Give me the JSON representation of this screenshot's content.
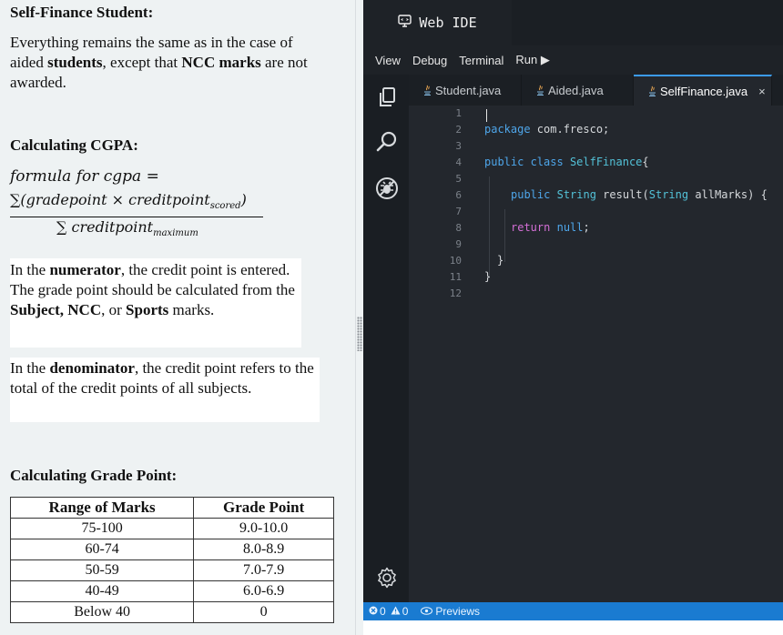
{
  "left": {
    "self_finance_heading": "Self-Finance  Student:",
    "self_finance_text": {
      "p1": "Everything remains the same as in the case of aided ",
      "b1": "students",
      "p2": ", except that ",
      "b2": "NCC marks",
      "p3": " are not awarded."
    },
    "cgpa_heading": "Calculating CGPA:",
    "formula": {
      "label": "formula for cgpa =",
      "numerator": "∑(gradepoint × creditpoint",
      "numerator_sub": "scored",
      "numerator_close": ")",
      "denominator": "∑ creditpoint",
      "denominator_sub": "maximum"
    },
    "numerator_text": {
      "p1": "In the ",
      "b1": "numerator",
      "p2": ", the credit point is entered. The grade point should be calculated from the ",
      "b2": "Subject, NCC",
      "p3": ", or ",
      "b3": "Sports",
      "p4": " marks."
    },
    "denominator_text": {
      "p1": "In the ",
      "b1": "denominator",
      "p2": ", the credit point refers to the total of the credit points of all subjects."
    },
    "grade_heading": "Calculating Grade Point:",
    "grade_table": {
      "headers": [
        "Range of Marks",
        "Grade Point"
      ],
      "rows": [
        [
          "75-100",
          "9.0-10.0"
        ],
        [
          "60-74",
          "8.0-8.9"
        ],
        [
          "50-59",
          "7.0-7.9"
        ],
        [
          "40-49",
          "6.0-6.9"
        ],
        [
          "Below 40",
          "0"
        ]
      ]
    }
  },
  "ide": {
    "title": "Web IDE",
    "menu": [
      "View",
      "Debug",
      "Terminal",
      "Run ▶"
    ],
    "tabs": [
      {
        "label": "Student.java",
        "active": false
      },
      {
        "label": "Aided.java",
        "active": false
      },
      {
        "label": "SelfFinance.java",
        "active": true,
        "close": "×"
      }
    ],
    "line_numbers": [
      "1",
      "2",
      "3",
      "4",
      "5",
      "6",
      "7",
      "8",
      "9",
      "10",
      "11",
      "12"
    ],
    "code": {
      "l2_kw": "package",
      "l2_rest": " com.fresco;",
      "l4_kw1": "public",
      "l4_kw2": " class ",
      "l4_cls": "SelfFinance",
      "l4_rest": "{",
      "l6_kw1": "public",
      "l6_sp": " ",
      "l6_cls1": "String",
      "l6_rest1": " result(",
      "l6_cls2": "String",
      "l6_rest2": " allMarks) {",
      "l8_kw": "return",
      "l8_sp": " ",
      "l8_null": "null",
      "l8_rest": ";",
      "l10": "}",
      "l11": "}"
    },
    "status": {
      "errors": "0",
      "warnings": "0",
      "previews": "Previews"
    },
    "colors": {
      "accent": "#3b9bf0",
      "status_bar": "#1a7bd1",
      "keyword": "#4ea6ea",
      "return_keyword": "#d46fd6",
      "class_name": "#53c2d8"
    }
  }
}
